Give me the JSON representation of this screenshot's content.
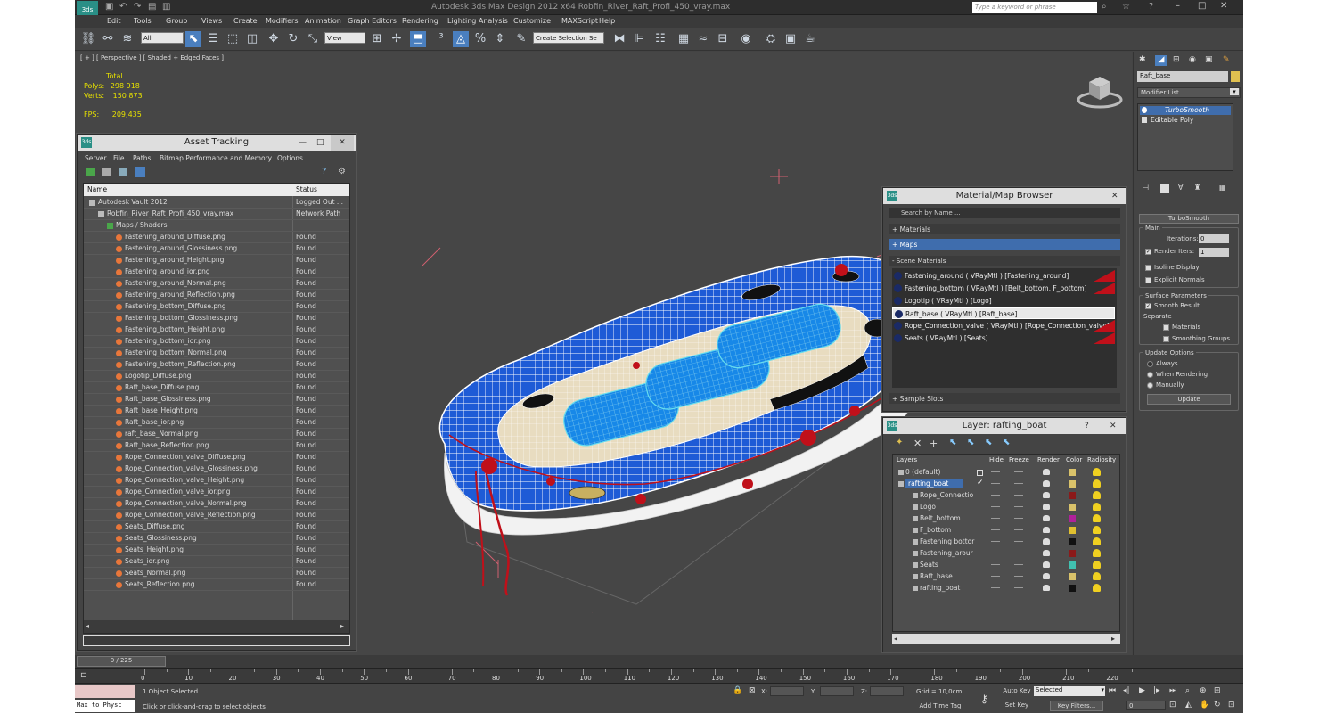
{
  "title_bar": {
    "title": "Autodesk 3ds Max Design 2012 x64      Robfin_River_Raft_Profi_450_vray.max",
    "search_placeholder": "Type a keyword or phrase"
  },
  "menu": [
    "Edit",
    "Tools",
    "Group",
    "Views",
    "Create",
    "Modifiers",
    "Animation",
    "Graph Editors",
    "Rendering",
    "Lighting Analysis",
    "Customize",
    "MAXScript",
    "Help"
  ],
  "toolbar": {
    "filter": "All",
    "ref_coord": "View",
    "selection_set": "Create Selection Se"
  },
  "viewport": {
    "label": "[ + ] [ Perspective ] [ Shaded + Edged Faces ]",
    "stats": {
      "total_label": "Total",
      "polys_label": "Polys:",
      "polys": "298 918",
      "verts_label": "Verts:",
      "verts": "150 873",
      "fps_label": "FPS:",
      "fps": "209,435"
    }
  },
  "asset_tracking": {
    "title": "Asset Tracking",
    "menu": [
      "Server",
      "File",
      "Paths",
      "Bitmap Performance and Memory",
      "Options"
    ],
    "columns": {
      "name": "Name",
      "status": "Status"
    },
    "rows": [
      {
        "name": "Autodesk Vault 2012",
        "status": "Logged Out ...",
        "indent": 0
      },
      {
        "name": "Robfin_River_Raft_Profi_450_vray.max",
        "status": "Network Path",
        "indent": 1
      },
      {
        "name": "Maps / Shaders",
        "status": "",
        "indent": 2
      },
      {
        "name": "Fastening_around_Diffuse.png",
        "status": "Found",
        "indent": 3
      },
      {
        "name": "Fastening_around_Glossiness.png",
        "status": "Found",
        "indent": 3
      },
      {
        "name": "Fastening_around_Height.png",
        "status": "Found",
        "indent": 3
      },
      {
        "name": "Fastening_around_ior.png",
        "status": "Found",
        "indent": 3
      },
      {
        "name": "Fastening_around_Normal.png",
        "status": "Found",
        "indent": 3
      },
      {
        "name": "Fastening_around_Reflection.png",
        "status": "Found",
        "indent": 3
      },
      {
        "name": "Fastening_bottom_Diffuse.png",
        "status": "Found",
        "indent": 3
      },
      {
        "name": "Fastening_bottom_Glossiness.png",
        "status": "Found",
        "indent": 3
      },
      {
        "name": "Fastening_bottom_Height.png",
        "status": "Found",
        "indent": 3
      },
      {
        "name": "Fastening_bottom_ior.png",
        "status": "Found",
        "indent": 3
      },
      {
        "name": "Fastening_bottom_Normal.png",
        "status": "Found",
        "indent": 3
      },
      {
        "name": "Fastening_bottom_Reflection.png",
        "status": "Found",
        "indent": 3
      },
      {
        "name": "Logotip_Diffuse.png",
        "status": "Found",
        "indent": 3
      },
      {
        "name": "Raft_base_Diffuse.png",
        "status": "Found",
        "indent": 3
      },
      {
        "name": "Raft_base_Glossiness.png",
        "status": "Found",
        "indent": 3
      },
      {
        "name": "Raft_base_Height.png",
        "status": "Found",
        "indent": 3
      },
      {
        "name": "Raft_base_ior.png",
        "status": "Found",
        "indent": 3
      },
      {
        "name": "raft_base_Normal.png",
        "status": "Found",
        "indent": 3
      },
      {
        "name": "Raft_base_Reflection.png",
        "status": "Found",
        "indent": 3
      },
      {
        "name": "Rope_Connection_valve_Diffuse.png",
        "status": "Found",
        "indent": 3
      },
      {
        "name": "Rope_Connection_valve_Glossiness.png",
        "status": "Found",
        "indent": 3
      },
      {
        "name": "Rope_Connection_valve_Height.png",
        "status": "Found",
        "indent": 3
      },
      {
        "name": "Rope_Connection_valve_ior.png",
        "status": "Found",
        "indent": 3
      },
      {
        "name": "Rope_Connection_valve_Normal.png",
        "status": "Found",
        "indent": 3
      },
      {
        "name": "Rope_Connection_valve_Reflection.png",
        "status": "Found",
        "indent": 3
      },
      {
        "name": "Seats_Diffuse.png",
        "status": "Found",
        "indent": 3
      },
      {
        "name": "Seats_Glossiness.png",
        "status": "Found",
        "indent": 3
      },
      {
        "name": "Seats_Height.png",
        "status": "Found",
        "indent": 3
      },
      {
        "name": "Seats_ior.png",
        "status": "Found",
        "indent": 3
      },
      {
        "name": "Seats_Normal.png",
        "status": "Found",
        "indent": 3
      },
      {
        "name": "Seats_Reflection.png",
        "status": "Found",
        "indent": 3
      }
    ]
  },
  "material_browser": {
    "title": "Material/Map Browser",
    "search": "Search by Name ...",
    "sections": {
      "materials": "+ Materials",
      "maps": "+ Maps",
      "scene": "- Scene Materials",
      "samples": "+ Sample Slots"
    },
    "items": [
      {
        "label": "Fastening_around  ( VRayMtl )  [Fastening_around]",
        "selected": false
      },
      {
        "label": "Fastening_bottom  ( VRayMtl )  [Belt_bottom, F_bottom]",
        "selected": false
      },
      {
        "label": "Logotip  ( VRayMtl )  [Logo]",
        "selected": false
      },
      {
        "label": "Raft_base  ( VRayMtl )  [Raft_base]",
        "selected": true
      },
      {
        "label": "Rope_Connection_valve  ( VRayMtl )  [Rope_Connection_valve]",
        "selected": false
      },
      {
        "label": "Seats  ( VRayMtl )  [Seats]",
        "selected": false
      }
    ]
  },
  "layer_window": {
    "title": "Layer: rafting_boat",
    "help": "?",
    "columns": [
      "Layers",
      "Hide",
      "Freeze",
      "Render",
      "Color",
      "Radiosity"
    ],
    "rows": [
      {
        "name": "0 (default)",
        "color": "#d9c26a",
        "level": 0,
        "active": false
      },
      {
        "name": "rafting_boat",
        "color": "#d9c26a",
        "level": 0,
        "active": true
      },
      {
        "name": "Rope_Connectio",
        "color": "#8b1a1a",
        "level": 1,
        "active": false
      },
      {
        "name": "Logo",
        "color": "#d9c26a",
        "level": 1,
        "active": false
      },
      {
        "name": "Belt_bottom",
        "color": "#b0209a",
        "level": 1,
        "active": false
      },
      {
        "name": "F_bottom",
        "color": "#e0c030",
        "level": 1,
        "active": false
      },
      {
        "name": "Fastening bottor",
        "color": "#111111",
        "level": 1,
        "active": false
      },
      {
        "name": "Fastening_arour",
        "color": "#8b1a1a",
        "level": 1,
        "active": false
      },
      {
        "name": "Seats",
        "color": "#40c0b0",
        "level": 1,
        "active": false
      },
      {
        "name": "Raft_base",
        "color": "#d9c26a",
        "level": 1,
        "active": false
      },
      {
        "name": "rafting_boat",
        "color": "#111111",
        "level": 1,
        "active": false
      }
    ]
  },
  "command_panel": {
    "object_name": "Raft_base",
    "modifier_list": "Modifier List",
    "stack": [
      {
        "label": "TurboSmooth",
        "selected": true
      },
      {
        "label": "Editable Poly",
        "selected": false
      }
    ],
    "rollout_title": "TurboSmooth",
    "main_label": "Main",
    "iterations_label": "Iterations:",
    "iterations": "0",
    "render_iters_label": "Render Iters:",
    "render_iters": "1",
    "isoline": "Isoline Display",
    "explicit": "Explicit Normals",
    "surface_label": "Surface Parameters",
    "smooth_result": "Smooth Result",
    "separate_label": "Separate",
    "materials": "Materials",
    "smoothing_groups": "Smoothing Groups",
    "update_label": "Update Options",
    "always": "Always",
    "when_rendering": "When Rendering",
    "manually": "Manually",
    "update_btn": "Update"
  },
  "timeline": {
    "frame": "0 / 225",
    "ticks": [
      "0",
      "10",
      "20",
      "30",
      "40",
      "50",
      "60",
      "70",
      "80",
      "90",
      "100",
      "110",
      "120",
      "130",
      "140",
      "150",
      "160",
      "170",
      "180",
      "190",
      "200",
      "210",
      "220"
    ]
  },
  "status": {
    "maxscript": "Max to Physc",
    "selected": "1 Object Selected",
    "prompt": "Click or click-and-drag to select objects",
    "x_label": "X:",
    "y_label": "Y:",
    "z_label": "Z:",
    "grid": "Grid = 10,0cm",
    "add_time_tag": "Add Time Tag",
    "auto_key": "Auto Key",
    "selected_dd": "Selected",
    "set_key": "Set Key",
    "key_filters": "Key Filters...",
    "frame_field": "0"
  }
}
